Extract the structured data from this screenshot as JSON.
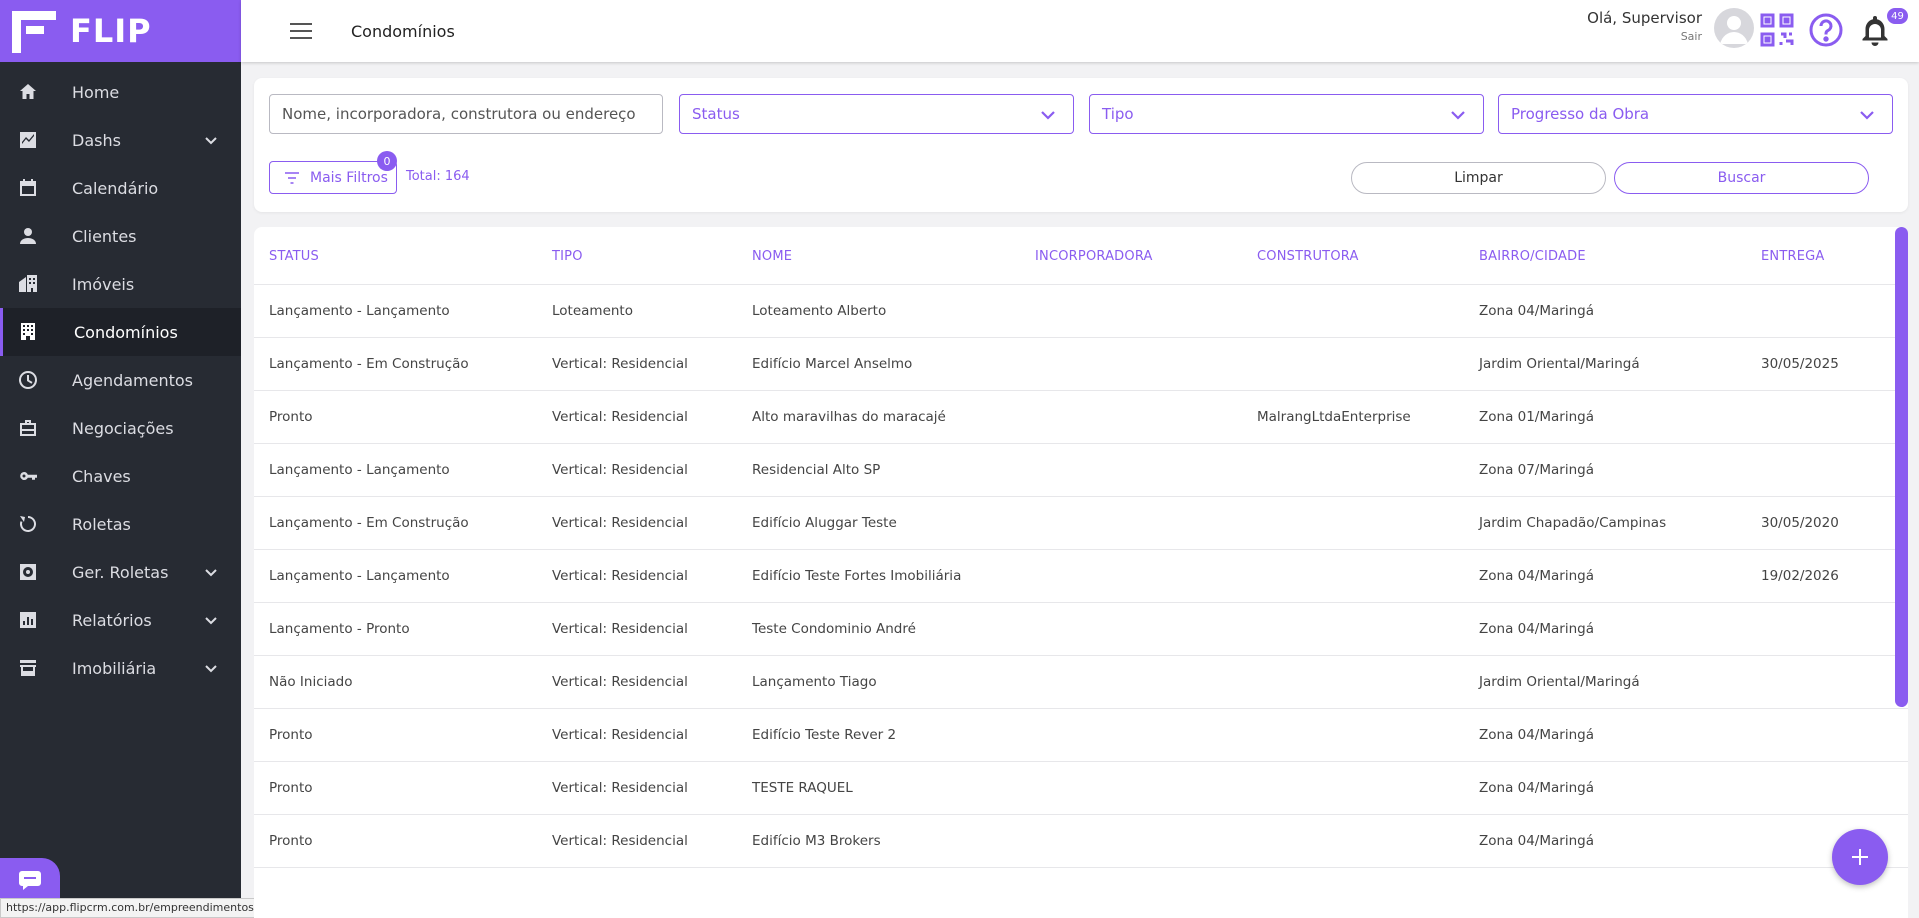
{
  "brand": {
    "name": "FLIP"
  },
  "colors": {
    "accent": "#8a5cf0",
    "sidebar": "#272b33",
    "sidebar_active": "#1e2128"
  },
  "sidebar": {
    "items": [
      {
        "label": "Home",
        "icon": "home-icon",
        "expandable": false,
        "active": false
      },
      {
        "label": "Dashs",
        "icon": "chart-icon",
        "expandable": true,
        "active": false
      },
      {
        "label": "Calendário",
        "icon": "calendar-icon",
        "expandable": false,
        "active": false
      },
      {
        "label": "Clientes",
        "icon": "person-icon",
        "expandable": false,
        "active": false
      },
      {
        "label": "Imóveis",
        "icon": "buildings-icon",
        "expandable": false,
        "active": false
      },
      {
        "label": "Condomínios",
        "icon": "apartment-icon",
        "expandable": false,
        "active": true
      },
      {
        "label": "Agendamentos",
        "icon": "clock-icon",
        "expandable": false,
        "active": false
      },
      {
        "label": "Negociações",
        "icon": "briefcase-icon",
        "expandable": false,
        "active": false
      },
      {
        "label": "Chaves",
        "icon": "key-icon",
        "expandable": false,
        "active": false
      },
      {
        "label": "Roletas",
        "icon": "roulette-icon",
        "expandable": false,
        "active": false
      },
      {
        "label": "Ger. Roletas",
        "icon": "roulette-settings-icon",
        "expandable": true,
        "active": false
      },
      {
        "label": "Relatórios",
        "icon": "report-icon",
        "expandable": true,
        "active": false
      },
      {
        "label": "Imobiliária",
        "icon": "store-icon",
        "expandable": true,
        "active": false
      }
    ]
  },
  "header": {
    "title": "Condomínios",
    "greeting": "Olá, Supervisor",
    "logout": "Sair",
    "notifications_count": "49"
  },
  "filters": {
    "search_placeholder": "Nome, incorporadora, construtora ou endereço",
    "status_label": "Status",
    "tipo_label": "Tipo",
    "progresso_label": "Progresso da Obra",
    "more_filters_label": "Mais Filtros",
    "more_filters_count": "0",
    "total_label": "Total: 164",
    "clear_label": "Limpar",
    "search_label": "Buscar"
  },
  "table": {
    "columns": [
      "STATUS",
      "TIPO",
      "NOME",
      "INCORPORADORA",
      "CONSTRUTORA",
      "BAIRRO/CIDADE",
      "ENTREGA"
    ],
    "rows": [
      [
        "Lançamento - Lançamento",
        "Loteamento",
        "Loteamento Alberto",
        "",
        "",
        "Zona 04/Maringá",
        ""
      ],
      [
        "Lançamento - Em Construção",
        "Vertical: Residencial",
        "Edifício Marcel Anselmo",
        "",
        "",
        "Jardim Oriental/Maringá",
        "30/05/2025"
      ],
      [
        "Pronto",
        "Vertical: Residencial",
        "Alto maravilhas do maracajé",
        "",
        "MalrangLtdaEnterprise",
        "Zona 01/Maringá",
        ""
      ],
      [
        "Lançamento - Lançamento",
        "Vertical: Residencial",
        "Residencial Alto SP",
        "",
        "",
        "Zona 07/Maringá",
        ""
      ],
      [
        "Lançamento - Em Construção",
        "Vertical: Residencial",
        "Edifício Aluggar Teste",
        "",
        "",
        "Jardim Chapadão/Campinas",
        "30/05/2020"
      ],
      [
        "Lançamento - Lançamento",
        "Vertical: Residencial",
        "Edifício Teste Fortes Imobiliária",
        "",
        "",
        "Zona 04/Maringá",
        "19/02/2026"
      ],
      [
        "Lançamento - Pronto",
        "Vertical: Residencial",
        "Teste Condominio André",
        "",
        "",
        "Zona 04/Maringá",
        ""
      ],
      [
        "Não Iniciado",
        "Vertical: Residencial",
        "Lançamento Tiago",
        "",
        "",
        "Jardim Oriental/Maringá",
        ""
      ],
      [
        "Pronto",
        "Vertical: Residencial",
        "Edifício Teste Rever 2",
        "",
        "",
        "Zona 04/Maringá",
        ""
      ],
      [
        "Pronto",
        "Vertical: Residencial",
        "TESTE RAQUEL",
        "",
        "",
        "Zona 04/Maringá",
        ""
      ],
      [
        "Pronto",
        "Vertical: Residencial",
        "Edifício M3 Brokers",
        "",
        "",
        "Zona 04/Maringá",
        ""
      ]
    ]
  },
  "status_bar": {
    "url": "https://app.flipcrm.com.br/empreendimentos"
  }
}
